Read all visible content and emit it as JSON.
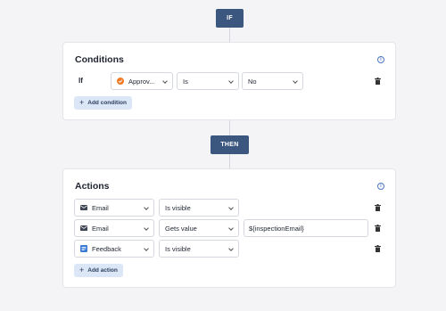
{
  "if_pill": "IF",
  "then_pill": "THEN",
  "conditions": {
    "title": "Conditions",
    "row": {
      "label": "If",
      "field": "Approv...",
      "operator": "Is",
      "value": "No"
    },
    "add_label": "Add condition"
  },
  "actions": {
    "title": "Actions",
    "rows": [
      {
        "field": "Email",
        "field_icon": "mail-icon",
        "action": "Is visible",
        "value": ""
      },
      {
        "field": "Email",
        "field_icon": "mail-icon",
        "action": "Gets value",
        "value": "${inspectionEmail}"
      },
      {
        "field": "Feedback",
        "field_icon": "list-icon",
        "action": "Is visible",
        "value": ""
      }
    ],
    "add_label": "Add action"
  },
  "colors": {
    "pill": "#3b5780",
    "accent": "#4a78c2",
    "approval_icon": "#f07a26",
    "add_button_bg": "#dbe6f7"
  }
}
